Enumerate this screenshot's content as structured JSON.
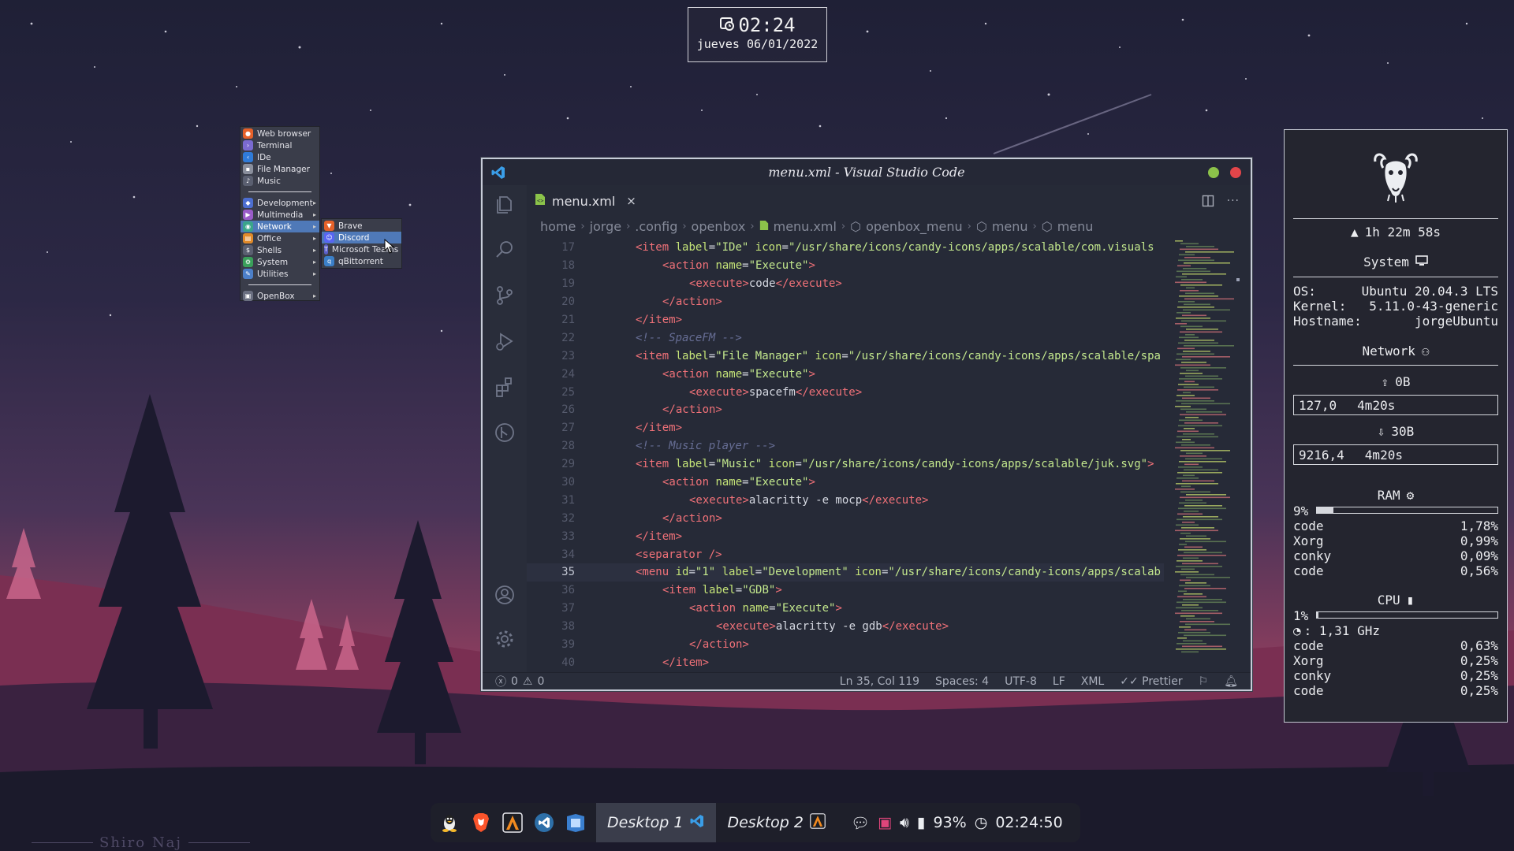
{
  "clock_widget": {
    "time": "02:24",
    "date": "jueves 06/01/2022"
  },
  "openbox_menu": {
    "items": [
      {
        "label": "Web browser",
        "color": "#e5612a"
      },
      {
        "label": "Terminal",
        "color": "#7a6ad0"
      },
      {
        "label": "IDe",
        "color": "#2f7bd8"
      },
      {
        "label": "File Manager",
        "color": "#8a8f9c"
      },
      {
        "label": "Music",
        "color": "#5a5f70"
      }
    ],
    "categories": [
      {
        "label": "Development"
      },
      {
        "label": "Multimedia"
      },
      {
        "label": "Network",
        "active": true
      },
      {
        "label": "Office"
      },
      {
        "label": "Shells"
      },
      {
        "label": "System"
      },
      {
        "label": "Utilities"
      }
    ],
    "footer": "OpenBox",
    "arrow": "▸"
  },
  "network_submenu": {
    "items": [
      {
        "label": "Brave"
      },
      {
        "label": "Discord",
        "active": true
      },
      {
        "label": "Microsoft Teams"
      },
      {
        "label": "qBittorrent"
      }
    ]
  },
  "vscode": {
    "title": "menu.xml - Visual Studio Code",
    "tab": {
      "label": "menu.xml",
      "close": "×"
    },
    "breadcrumbs": [
      "home",
      "jorge",
      ".config",
      "openbox",
      "menu.xml",
      "openbox_menu",
      "menu",
      "menu"
    ],
    "crumb_sep": "›",
    "code_lines": [
      {
        "n": "17",
        "indent": 2,
        "html": "<span class=\"tag\">&lt;item</span> <span class=\"attr\">label</span><span class=\"tx\">=</span><span class=\"str\">\"IDe\"</span> <span class=\"attr\">icon</span><span class=\"tx\">=</span><span class=\"str\">\"/usr/share/icons/candy-icons/apps/scalable/com.visuals</span>"
      },
      {
        "n": "18",
        "indent": 3,
        "html": "<span class=\"tag\">&lt;action</span> <span class=\"attr\">name</span><span class=\"tx\">=</span><span class=\"str\">\"Execute\"</span><span class=\"tag\">&gt;</span>"
      },
      {
        "n": "19",
        "indent": 4,
        "html": "<span class=\"tag\">&lt;execute&gt;</span><span class=\"tx\">code</span><span class=\"tag\">&lt;/execute&gt;</span>"
      },
      {
        "n": "20",
        "indent": 3,
        "html": "<span class=\"tag\">&lt;/action&gt;</span>"
      },
      {
        "n": "21",
        "indent": 2,
        "html": "<span class=\"tag\">&lt;/item&gt;</span>"
      },
      {
        "n": "22",
        "indent": 2,
        "html": "<span class=\"cmt\">&lt;!-- SpaceFM --&gt;</span>"
      },
      {
        "n": "23",
        "indent": 2,
        "html": "<span class=\"tag\">&lt;item</span> <span class=\"attr\">label</span><span class=\"tx\">=</span><span class=\"str\">\"File Manager\"</span> <span class=\"attr\">icon</span><span class=\"tx\">=</span><span class=\"str\">\"/usr/share/icons/candy-icons/apps/scalable/spa</span>"
      },
      {
        "n": "24",
        "indent": 3,
        "html": "<span class=\"tag\">&lt;action</span> <span class=\"attr\">name</span><span class=\"tx\">=</span><span class=\"str\">\"Execute\"</span><span class=\"tag\">&gt;</span>"
      },
      {
        "n": "25",
        "indent": 4,
        "html": "<span class=\"tag\">&lt;execute&gt;</span><span class=\"tx\">spacefm</span><span class=\"tag\">&lt;/execute&gt;</span>"
      },
      {
        "n": "26",
        "indent": 3,
        "html": "<span class=\"tag\">&lt;/action&gt;</span>"
      },
      {
        "n": "27",
        "indent": 2,
        "html": "<span class=\"tag\">&lt;/item&gt;</span>"
      },
      {
        "n": "28",
        "indent": 2,
        "html": "<span class=\"cmt\">&lt;!-- Music player --&gt;</span>"
      },
      {
        "n": "29",
        "indent": 2,
        "html": "<span class=\"tag\">&lt;item</span> <span class=\"attr\">label</span><span class=\"tx\">=</span><span class=\"str\">\"Music\"</span> <span class=\"attr\">icon</span><span class=\"tx\">=</span><span class=\"str\">\"/usr/share/icons/candy-icons/apps/scalable/juk.svg\"</span><span class=\"tag\">&gt;</span>"
      },
      {
        "n": "30",
        "indent": 3,
        "html": "<span class=\"tag\">&lt;action</span> <span class=\"attr\">name</span><span class=\"tx\">=</span><span class=\"str\">\"Execute\"</span><span class=\"tag\">&gt;</span>"
      },
      {
        "n": "31",
        "indent": 4,
        "html": "<span class=\"tag\">&lt;execute&gt;</span><span class=\"tx\">alacritty -e mocp</span><span class=\"tag\">&lt;/execute&gt;</span>"
      },
      {
        "n": "32",
        "indent": 3,
        "html": "<span class=\"tag\">&lt;/action&gt;</span>"
      },
      {
        "n": "33",
        "indent": 2,
        "html": "<span class=\"tag\">&lt;/item&gt;</span>"
      },
      {
        "n": "34",
        "indent": 2,
        "html": "<span class=\"tag\">&lt;separator /&gt;</span>"
      },
      {
        "n": "35",
        "indent": 2,
        "current": true,
        "html": "<span class=\"tag\">&lt;menu</span> <span class=\"attr\">id</span><span class=\"tx\">=</span><span class=\"str\">\"1\"</span> <span class=\"attr\">label</span><span class=\"tx\">=</span><span class=\"str\">\"Development\"</span> <span class=\"attr\">icon</span><span class=\"tx\">=</span><span class=\"str\">\"/usr/share/icons/candy-icons/apps/scalab</span>"
      },
      {
        "n": "36",
        "indent": 3,
        "html": "<span class=\"tag\">&lt;item</span> <span class=\"attr\">label</span><span class=\"tx\">=</span><span class=\"str\">\"GDB\"</span><span class=\"tag\">&gt;</span>"
      },
      {
        "n": "37",
        "indent": 4,
        "html": "<span class=\"tag\">&lt;action</span> <span class=\"attr\">name</span><span class=\"tx\">=</span><span class=\"str\">\"Execute\"</span><span class=\"tag\">&gt;</span>"
      },
      {
        "n": "38",
        "indent": 5,
        "html": "<span class=\"tag\">&lt;execute&gt;</span><span class=\"tx\">alacritty -e gdb</span><span class=\"tag\">&lt;/execute&gt;</span>"
      },
      {
        "n": "39",
        "indent": 4,
        "html": "<span class=\"tag\">&lt;/action&gt;</span>"
      },
      {
        "n": "40",
        "indent": 3,
        "html": "<span class=\"tag\">&lt;/item&gt;</span>"
      }
    ],
    "status": {
      "errors": "0",
      "warnings": "0",
      "position": "Ln 35, Col 119",
      "spaces": "Spaces: 4",
      "encoding": "UTF-8",
      "eol": "LF",
      "language": "XML",
      "formatter": "Prettier"
    }
  },
  "conky": {
    "uptime": "1h 22m 58s",
    "system_title": "System",
    "os_label": "OS:",
    "os_value": "Ubuntu 20.04.3 LTS",
    "kernel_label": "Kernel:",
    "kernel_value": "5.11.0-43-generic",
    "hostname_label": "Hostname:",
    "hostname_value": "jorgeUbuntu",
    "network_title": "Network",
    "upload_label": "0B",
    "upload_graph": [
      "127,0",
      "4m20s"
    ],
    "download_label": "30B",
    "download_graph": [
      "9216,4",
      "4m20s"
    ],
    "ram_title": "RAM",
    "ram_percent": "9%",
    "ram_fraction": 0.09,
    "ram_procs": [
      {
        "name": "code",
        "value": "1,78%"
      },
      {
        "name": "Xorg",
        "value": "0,99%"
      },
      {
        "name": "conky",
        "value": "0,09%"
      },
      {
        "name": "code",
        "value": "0,56%"
      }
    ],
    "cpu_title": "CPU",
    "cpu_percent": "1%",
    "cpu_fraction": 0.01,
    "cpu_freq": ": 1,31 GHz",
    "cpu_procs": [
      {
        "name": "code",
        "value": "0,63%"
      },
      {
        "name": "Xorg",
        "value": "0,25%"
      },
      {
        "name": "conky",
        "value": "0,25%"
      },
      {
        "name": "code",
        "value": "0,25%"
      }
    ]
  },
  "taskbar": {
    "desktop1": "Desktop 1",
    "desktop2": "Desktop 2",
    "battery": "93%",
    "time": "02:24:50"
  },
  "signature": "Shiro Naj"
}
